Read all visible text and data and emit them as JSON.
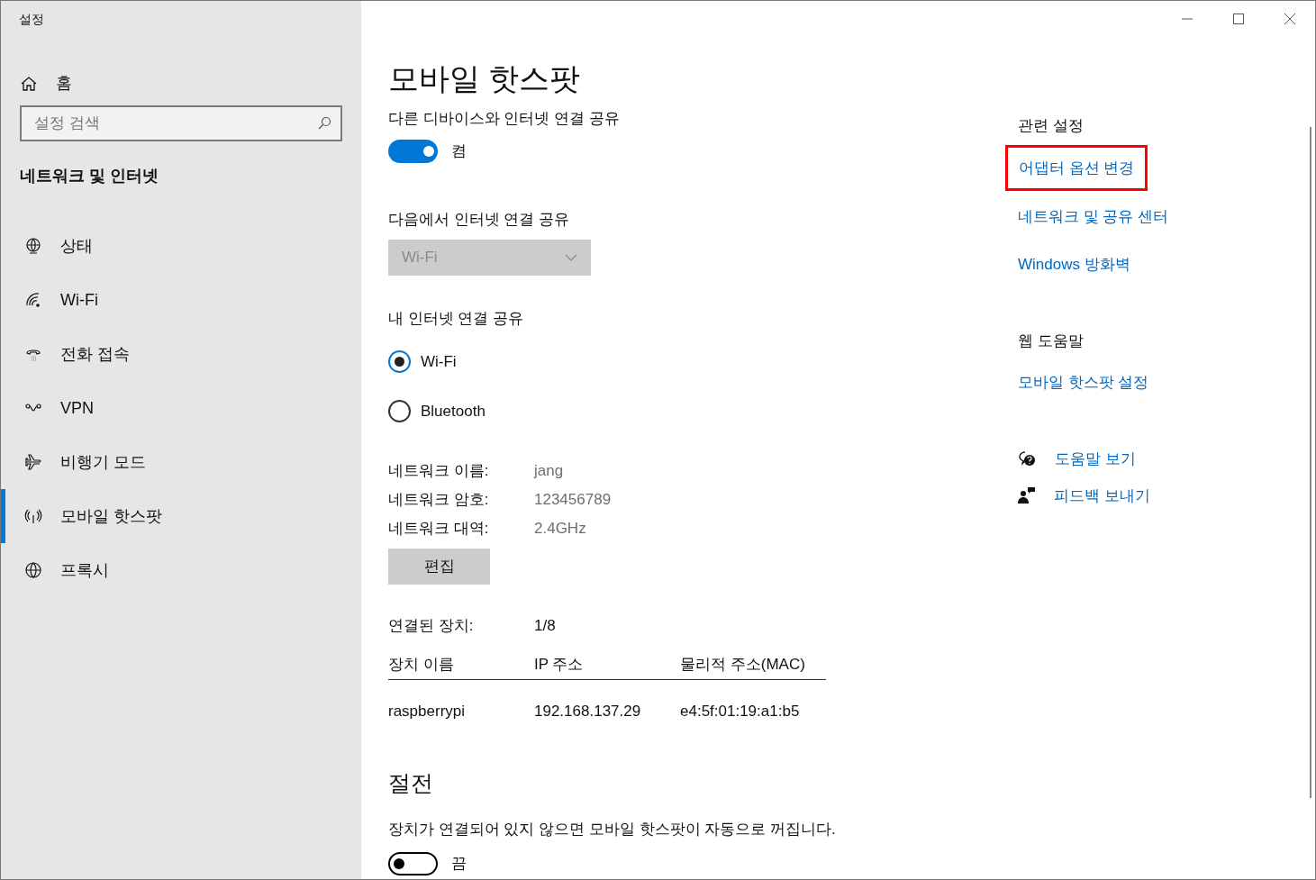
{
  "window": {
    "title": "설정"
  },
  "sidebar": {
    "home": "홈",
    "search": {
      "placeholder": "설정 검색"
    },
    "section": "네트워크 및 인터넷",
    "items": [
      {
        "label": "상태",
        "kind": "status",
        "selected": false
      },
      {
        "label": "Wi-Fi",
        "kind": "wifi",
        "selected": false
      },
      {
        "label": "전화 접속",
        "kind": "dialup",
        "selected": false
      },
      {
        "label": "VPN",
        "kind": "vpn",
        "selected": false
      },
      {
        "label": "비행기 모드",
        "kind": "airplane",
        "selected": false
      },
      {
        "label": "모바일 핫스팟",
        "kind": "hotspot",
        "selected": true
      },
      {
        "label": "프록시",
        "kind": "proxy",
        "selected": false
      }
    ]
  },
  "main": {
    "title": "모바일 핫스팟",
    "share": {
      "label": "다른 디바이스와 인터넷 연결 공유",
      "on": true,
      "state": "켬"
    },
    "share_from": {
      "label": "다음에서 인터넷 연결 공유",
      "value": "Wi-Fi",
      "disabled": true
    },
    "share_over": {
      "label": "내 인터넷 연결 공유",
      "options": [
        {
          "label": "Wi-Fi",
          "selected": true
        },
        {
          "label": "Bluetooth",
          "selected": false
        }
      ]
    },
    "network": [
      {
        "label": "네트워크 이름:",
        "value": "jang"
      },
      {
        "label": "네트워크 암호:",
        "value": "123456789"
      },
      {
        "label": "네트워크 대역:",
        "value": "2.4GHz"
      }
    ],
    "edit_button": "편집",
    "connected": {
      "label": "연결된 장치:",
      "value": "1/8"
    },
    "table": {
      "columns": [
        "장치 이름",
        "IP 주소",
        "물리적 주소(MAC)"
      ],
      "rows": [
        [
          "raspberrypi",
          "192.168.137.29",
          "e4:5f:01:19:a1:b5"
        ]
      ]
    },
    "power_saving": {
      "title": "절전",
      "description": "장치가 연결되어 있지 않으면 모바일 핫스팟이 자동으로 꺼집니다.",
      "on": false,
      "state": "끔"
    }
  },
  "related": {
    "title": "관련 설정",
    "links": [
      {
        "label": "어댑터 옵션 변경",
        "highlighted": true
      },
      {
        "label": "네트워크 및 공유 센터",
        "highlighted": false
      },
      {
        "label": "Windows 방화벽",
        "highlighted": false
      }
    ]
  },
  "web_help": {
    "title": "웹 도움말",
    "links": [
      "모바일 핫스팟 설정"
    ]
  },
  "help_links": [
    {
      "label": "도움말 보기",
      "kind": "help"
    },
    {
      "label": "피드백 보내기",
      "kind": "feedback"
    }
  ]
}
